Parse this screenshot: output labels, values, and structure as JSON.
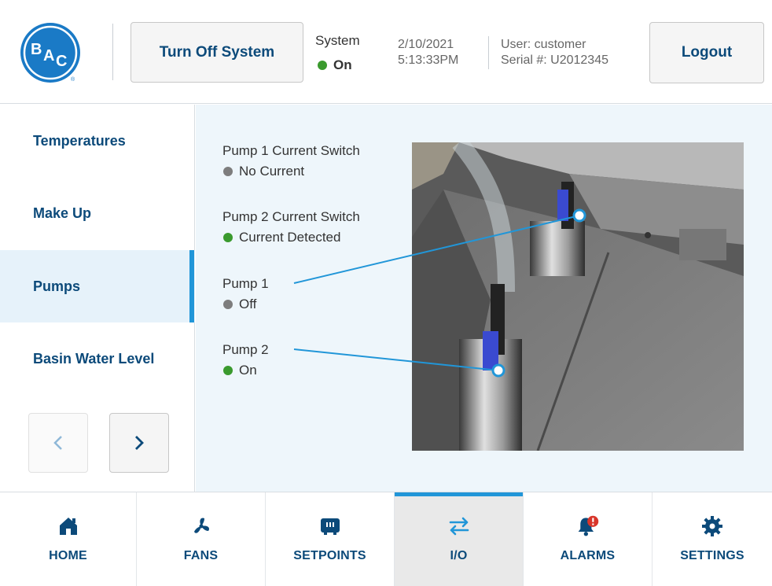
{
  "header": {
    "logo_text": "BAC",
    "turn_off_label": "Turn Off System",
    "system_label": "System",
    "system_status": "On",
    "date": "2/10/2021",
    "time": "5:13:33PM",
    "user": "User: customer",
    "serial": "Serial #: U2012345",
    "logout_label": "Logout"
  },
  "sidebar": {
    "items": [
      {
        "label": "Temperatures"
      },
      {
        "label": "Make Up"
      },
      {
        "label": "Pumps"
      },
      {
        "label": "Basin Water Level"
      }
    ],
    "active_index": 2
  },
  "io": [
    {
      "label": "Pump 1 Current Switch",
      "status": "No Current",
      "color": "#7d7d7d"
    },
    {
      "label": "Pump 2 Current Switch",
      "status": "Current Detected",
      "color": "#3a9a2e"
    },
    {
      "label": "Pump 1",
      "status": "Off",
      "color": "#7d7d7d"
    },
    {
      "label": "Pump 2",
      "status": "On",
      "color": "#3a9a2e"
    }
  ],
  "nav": [
    {
      "label": "HOME",
      "icon": "home-icon"
    },
    {
      "label": "FANS",
      "icon": "fan-icon"
    },
    {
      "label": "SETPOINTS",
      "icon": "setpoints-icon"
    },
    {
      "label": "I/O",
      "icon": "io-arrows-icon"
    },
    {
      "label": "ALARMS",
      "icon": "alarm-bell-icon"
    },
    {
      "label": "SETTINGS",
      "icon": "gear-icon"
    }
  ],
  "nav_active_index": 3,
  "colors": {
    "brand_blue": "#0c4a7a",
    "accent_blue": "#2196d8",
    "status_green": "#3a9a2e",
    "status_grey": "#7d7d7d",
    "alarm_red": "#d8352a"
  }
}
